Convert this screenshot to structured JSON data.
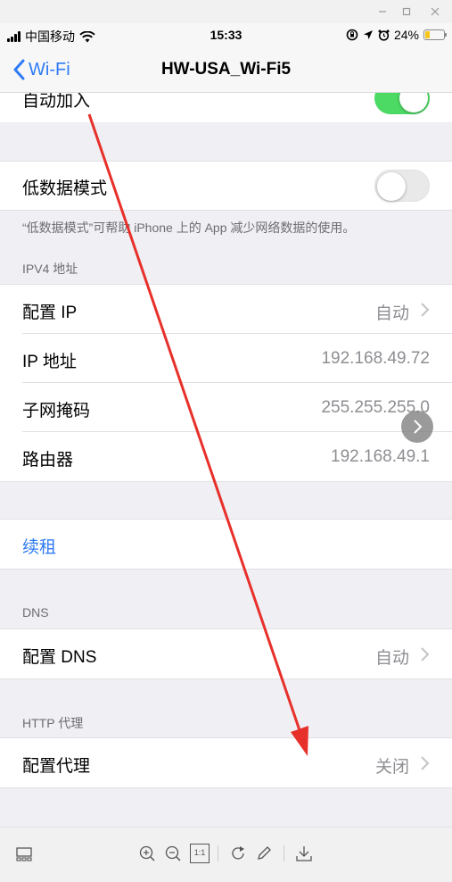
{
  "status": {
    "carrier": "中国移动",
    "time": "15:33",
    "battery": "24%",
    "battery_level": 0.24
  },
  "nav": {
    "back_label": "Wi-Fi",
    "title": "HW-USA_Wi-Fi5"
  },
  "auto_join": {
    "label": "自动加入",
    "on": true
  },
  "low_data": {
    "label": "低数据模式",
    "on": false,
    "footnote": "“低数据模式”可帮助 iPhone 上的 App 减少网络数据的使用。"
  },
  "ipv4": {
    "header": "IPV4 地址",
    "configure_ip": {
      "label": "配置 IP",
      "value": "自动"
    },
    "ip_address": {
      "label": "IP 地址",
      "value": "192.168.49.72"
    },
    "subnet": {
      "label": "子网掩码",
      "value": "255.255.255.0"
    },
    "router": {
      "label": "路由器",
      "value": "192.168.49.1"
    }
  },
  "renew": {
    "label": "续租"
  },
  "dns": {
    "header": "DNS",
    "configure": {
      "label": "配置 DNS",
      "value": "自动"
    }
  },
  "proxy": {
    "header": "HTTP 代理",
    "configure": {
      "label": "配置代理",
      "value": "关闭"
    }
  },
  "colors": {
    "accent": "#2f7bf5",
    "toggle_on": "#4cd964",
    "arrow": "#e8302a"
  },
  "icons": {
    "window": [
      "minimize-icon",
      "maximize-icon",
      "close-icon"
    ],
    "toolbar": [
      "thumbnail-icon",
      "zoom-in-icon",
      "zoom-out-icon",
      "actual-size-icon",
      "rotate-icon",
      "edit-icon",
      "download-icon"
    ]
  },
  "toolbar": {
    "actual_size_label": "1:1"
  }
}
